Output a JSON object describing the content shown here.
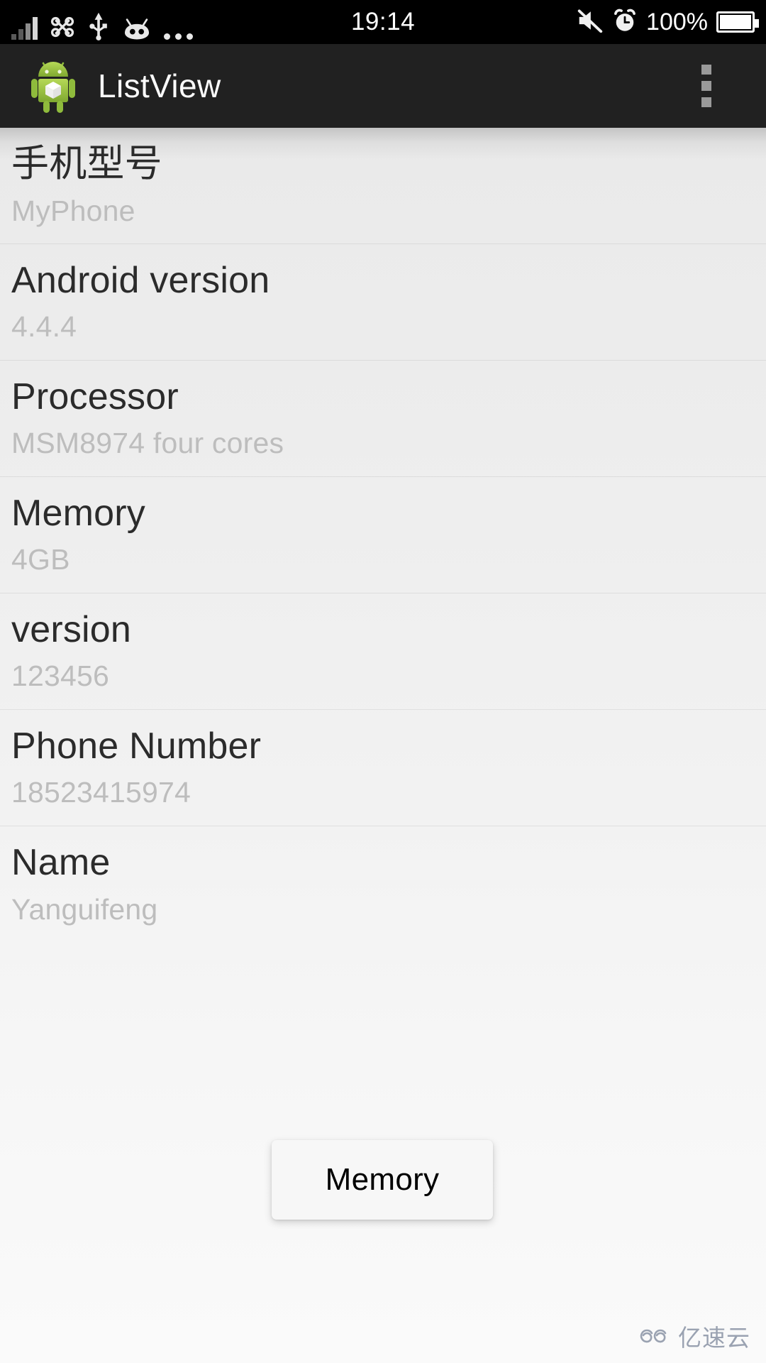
{
  "status_bar": {
    "time": "19:14",
    "battery_percent": "100%",
    "icons": {
      "signal": "signal-bars-icon",
      "carrier": "china-unicom-icon",
      "usb": "usb-icon",
      "robot": "cyanogenmod-head-icon",
      "more": "more-dots-icon",
      "mute": "volume-mute-icon",
      "alarm": "alarm-clock-icon",
      "battery": "battery-full-icon"
    },
    "colors": {
      "background": "#000000",
      "foreground": "#ffffff"
    }
  },
  "action_bar": {
    "title": "ListView",
    "app_icon": "android-robot-icon",
    "overflow_menu": "overflow-menu-icon",
    "colors": {
      "background": "#212121",
      "title": "#fafafa",
      "overflow_dots": "#9a9a9a"
    }
  },
  "list": {
    "rows": [
      {
        "primary": "手机型号",
        "secondary": "MyPhone",
        "cjk": true
      },
      {
        "primary": "Android version",
        "secondary": "4.4.4",
        "cjk": false
      },
      {
        "primary": "Processor",
        "secondary": "MSM8974 four cores",
        "cjk": false
      },
      {
        "primary": "Memory",
        "secondary": "4GB",
        "cjk": false
      },
      {
        "primary": "version",
        "secondary": "123456",
        "cjk": false
      },
      {
        "primary": "Phone Number",
        "secondary": "18523415974",
        "cjk": false
      },
      {
        "primary": "Name",
        "secondary": "Yanguifeng",
        "cjk": false
      }
    ],
    "colors": {
      "primary_text": "#2b2b2b",
      "secondary_text": "#bdbdbd",
      "background_top": "#eaeaea",
      "background_bottom": "#fafafa",
      "divider": "rgba(0,0,0,0.07)"
    }
  },
  "toast": {
    "message": "Memory",
    "colors": {
      "background": "#f7f7f7",
      "text": "#000000"
    }
  },
  "watermark": {
    "text": "亿速云",
    "icon": "cloud-icon",
    "color": "#9aa2b1"
  }
}
